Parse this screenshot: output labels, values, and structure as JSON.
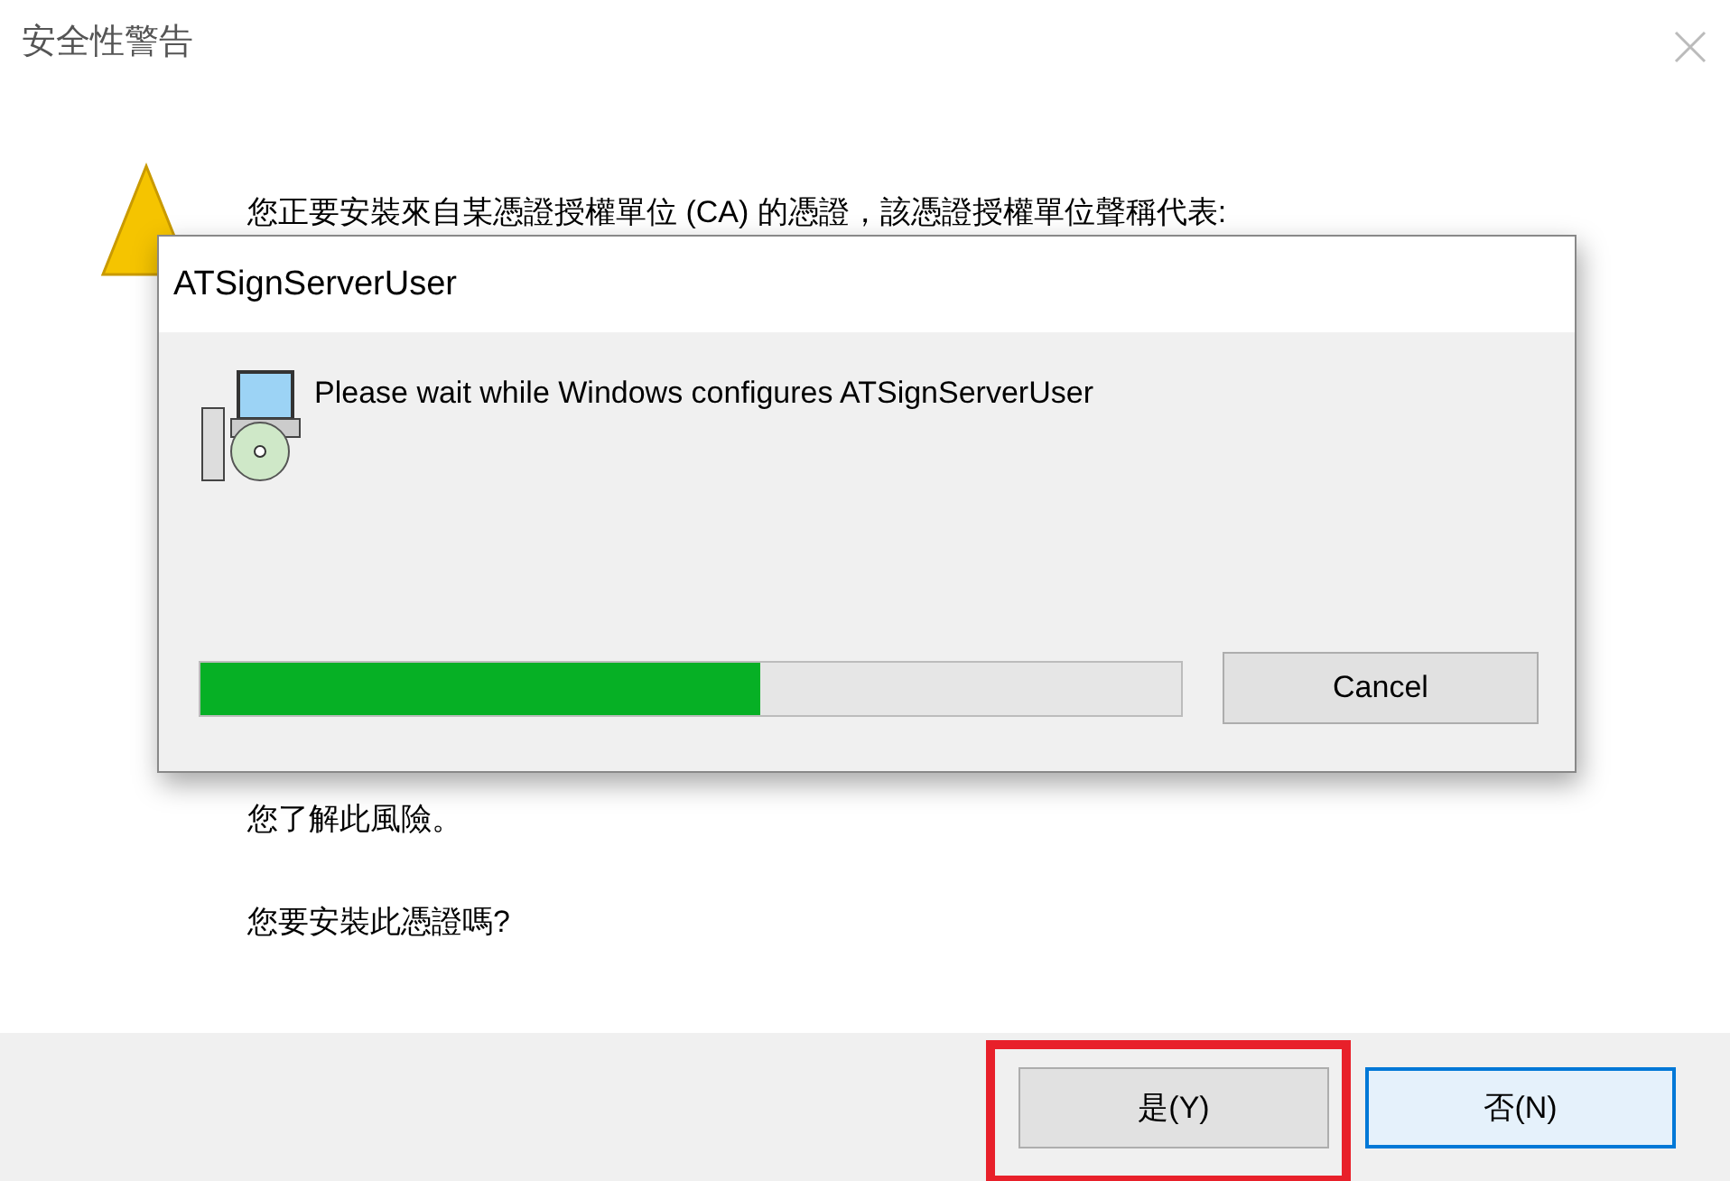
{
  "window": {
    "title": "安全性警告"
  },
  "message": {
    "first_line": "您正要安裝來自某憑證授權單位 (CA) 的憑證，該憑證授權單位聲稱代表:",
    "last_line": "您了解此風險。"
  },
  "question": "您要安裝此憑證嗎?",
  "buttons": [
    {
      "label": "是(Y)",
      "highlighted": true,
      "focused": false
    },
    {
      "label": "否(N)",
      "highlighted": false,
      "focused": true
    }
  ],
  "progress_dialog": {
    "title": "ATSignServerUser",
    "message": "Please wait while Windows configures ATSignServerUser",
    "level": 0.57,
    "cancel": "Cancel"
  }
}
